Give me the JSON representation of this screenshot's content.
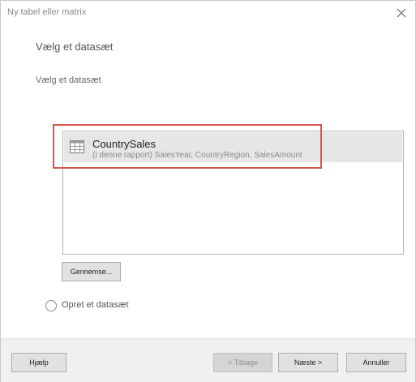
{
  "dialog": {
    "title": "Ny tabel eller matrix",
    "close_icon": "close-icon"
  },
  "main": {
    "heading": "Vælg et datasæt",
    "subheading": "Vælg et datasæt"
  },
  "datasets": {
    "items": [
      {
        "name": "CountrySales",
        "description": "(i denne rapport) SalesYear, CountryRegion, SalesAmount",
        "icon": "table-icon",
        "selected": true
      }
    ],
    "highlight_color": "#d9534f"
  },
  "actions": {
    "browse_label": "Gennemse...",
    "create_dataset_label": "Opret et datasæt"
  },
  "footer": {
    "help_label": "Hjælp",
    "back_label": "< Tilbage",
    "next_label": "Næste >",
    "cancel_label": "Annuller"
  }
}
